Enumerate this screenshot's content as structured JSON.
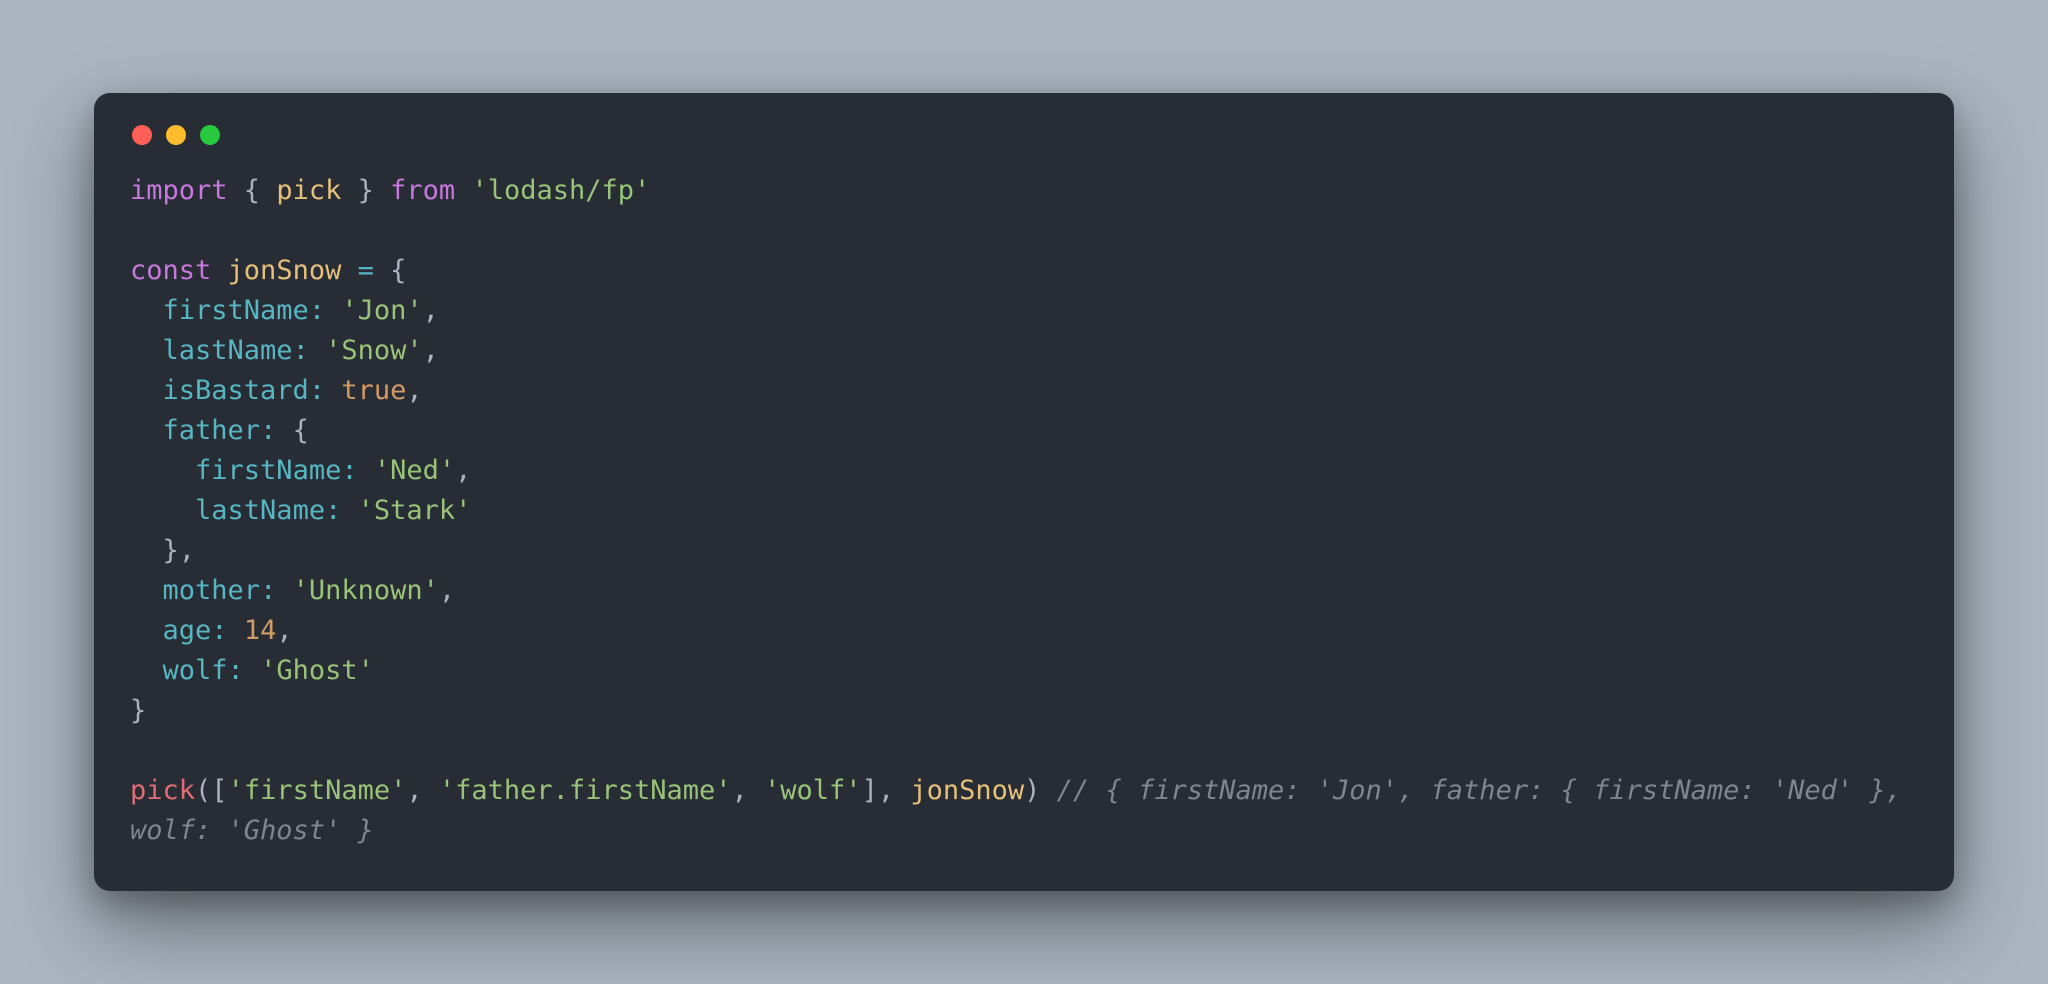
{
  "colors": {
    "background": "#aab5c0",
    "editor_bg": "#282c34",
    "default": "#abb2bf",
    "keyword": "#c678dd",
    "function": "#e5c07b",
    "string": "#98c379",
    "property": "#56b6c2",
    "number": "#d19a66",
    "boolean": "#d19a66",
    "call": "#e06c75",
    "comment": "#7f848e",
    "traffic_red": "#ff5f56",
    "traffic_yellow": "#ffbd2e",
    "traffic_green": "#27c93f"
  },
  "titlebar": {
    "buttons": [
      "close",
      "minimize",
      "zoom"
    ]
  },
  "code": {
    "line1": {
      "import": "import",
      "brace_open": " { ",
      "pick": "pick",
      "brace_close": " } ",
      "from": "from",
      "space": " ",
      "module": "'lodash/fp'"
    },
    "line3": {
      "const": "const",
      "space1": " ",
      "name": "jonSnow",
      "space2": " ",
      "eq": "=",
      "space3": " ",
      "brace": "{"
    },
    "line4": {
      "indent": "  ",
      "key": "firstName",
      "colon": ": ",
      "value": "'Jon'",
      "comma": ","
    },
    "line5": {
      "indent": "  ",
      "key": "lastName",
      "colon": ": ",
      "value": "'Snow'",
      "comma": ","
    },
    "line6": {
      "indent": "  ",
      "key": "isBastard",
      "colon": ": ",
      "value": "true",
      "comma": ","
    },
    "line7": {
      "indent": "  ",
      "key": "father",
      "colon": ": ",
      "brace": "{"
    },
    "line8": {
      "indent": "    ",
      "key": "firstName",
      "colon": ": ",
      "value": "'Ned'",
      "comma": ","
    },
    "line9": {
      "indent": "    ",
      "key": "lastName",
      "colon": ": ",
      "value": "'Stark'"
    },
    "line10": {
      "indent": "  ",
      "brace": "}",
      "comma": ","
    },
    "line11": {
      "indent": "  ",
      "key": "mother",
      "colon": ": ",
      "value": "'Unknown'",
      "comma": ","
    },
    "line12": {
      "indent": "  ",
      "key": "age",
      "colon": ": ",
      "value": "14",
      "comma": ","
    },
    "line13": {
      "indent": "  ",
      "key": "wolf",
      "colon": ": ",
      "value": "'Ghost'"
    },
    "line14": {
      "brace": "}"
    },
    "line16": {
      "call": "pick",
      "paren_open": "(",
      "arr_open": "[",
      "arg1": "'firstName'",
      "sep1": ", ",
      "arg2": "'father.firstName'",
      "sep2": ", ",
      "arg3": "'wolf'",
      "arr_close": "]",
      "sep3": ", ",
      "obj": "jonSnow",
      "paren_close": ")",
      "space": " ",
      "comment": "// { firstName: 'Jon', father: { firstName: 'Ned' }, wolf: 'Ghost' }"
    }
  }
}
